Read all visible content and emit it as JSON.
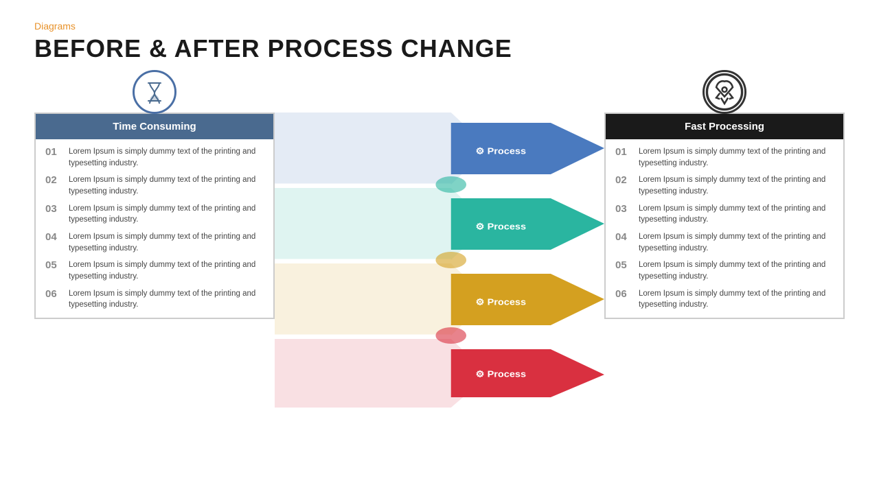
{
  "header": {
    "category": "Diagrams",
    "title": "BEFORE & AFTER PROCESS CHANGE"
  },
  "left_panel": {
    "icon_label": "hourglass-icon",
    "header": "Time Consuming",
    "items": [
      {
        "num": "01",
        "text": "Lorem Ipsum is simply dummy text of the printing and typesetting industry."
      },
      {
        "num": "02",
        "text": "Lorem Ipsum is simply dummy text of the printing and typesetting industry."
      },
      {
        "num": "03",
        "text": "Lorem Ipsum is simply dummy text of the printing and typesetting industry."
      },
      {
        "num": "04",
        "text": "Lorem Ipsum is simply dummy text of the printing and typesetting industry."
      },
      {
        "num": "05",
        "text": "Lorem Ipsum is simply dummy text of the printing and typesetting industry."
      },
      {
        "num": "06",
        "text": "Lorem Ipsum is simply dummy text of the printing and typesetting industry."
      }
    ]
  },
  "right_panel": {
    "icon_label": "rocket-icon",
    "header": "Fast Processing",
    "items": [
      {
        "num": "01",
        "text": "Lorem Ipsum is simply dummy text of the printing and typesetting industry."
      },
      {
        "num": "02",
        "text": "Lorem Ipsum is simply dummy text of the printing and typesetting industry."
      },
      {
        "num": "03",
        "text": "Lorem Ipsum is simply dummy text of the printing and typesetting industry."
      },
      {
        "num": "04",
        "text": "Lorem Ipsum is simply dummy text of the printing and typesetting industry."
      },
      {
        "num": "05",
        "text": "Lorem Ipsum is simply dummy text of the printing and typesetting industry."
      },
      {
        "num": "06",
        "text": "Lorem Ipsum is simply dummy text of the printing and typesetting industry."
      }
    ]
  },
  "processes": [
    {
      "label": "Process",
      "color": "#4a7abf"
    },
    {
      "label": "Process",
      "color": "#2ab5a0"
    },
    {
      "label": "Process",
      "color": "#d4a020"
    },
    {
      "label": "Process",
      "color": "#d93040"
    }
  ],
  "colors": {
    "orange": "#e8922a",
    "blue_header": "#4a6a8f",
    "dark_header": "#1a1a1a",
    "gear_icon": "#fff"
  }
}
